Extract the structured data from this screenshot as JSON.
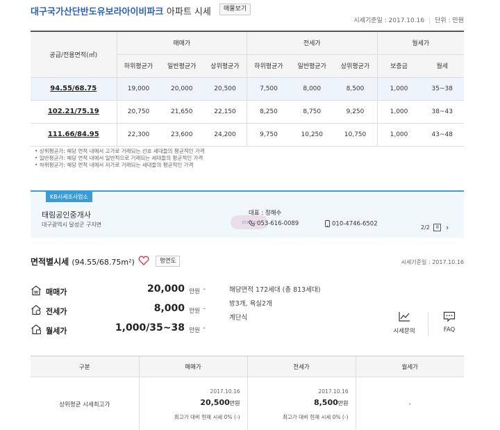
{
  "header": {
    "title": "대구국가산단반도유보라아이비파크",
    "title_suffix": "아파트 시세",
    "listing_button": "매물보기",
    "basis": "시세기준일 : 2017.10.16",
    "unit": "단위 : 만원"
  },
  "price_table": {
    "col_area": "공급/전용면적(㎡)",
    "groups": [
      "매매가",
      "전세가",
      "월세가"
    ],
    "subcols": [
      "하위평균가",
      "일반평균가",
      "상위평균가",
      "하위평균가",
      "일반평균가",
      "상위평균가",
      "보증금",
      "월세"
    ],
    "rows": [
      {
        "area": "94.55/68.75",
        "cells": [
          "19,000",
          "20,000",
          "20,500",
          "7,500",
          "8,000",
          "8,500",
          "1,000",
          "35~38"
        ]
      },
      {
        "area": "102.21/75.19",
        "cells": [
          "20,750",
          "21,650",
          "22,150",
          "8,250",
          "8,750",
          "9,250",
          "1,000",
          "38~43"
        ]
      },
      {
        "area": "111.66/84.95",
        "cells": [
          "22,300",
          "23,600",
          "24,200",
          "9,750",
          "10,250",
          "10,750",
          "1,000",
          "43~48"
        ]
      }
    ]
  },
  "notes": [
    "상위평균가: 해당 면적 내에서 고가로 거래되는 선호 세대들의 평균적인 가격",
    "일반평균가: 해당 면적 내에서 일반적으로 거래되는 세대들의 평균적인 가격",
    "하위평균가: 해당 면적 내에서 저가로 거래되는 세대들의 평균적인 가격"
  ],
  "agent": {
    "tag": "KB시세조사업소",
    "name": "태림공인중개사",
    "address": "대구광역시 달성군 구지면",
    "rep": "대표 : 정해수",
    "phone1": "053-616-0089",
    "phone2": "010-4746-6502",
    "pager": "2/2"
  },
  "area_section": {
    "title": "면적별시세",
    "title_area": "(94.55/68.75m²)",
    "floorplan_button": "평면도",
    "basis": "시세기준일 : 2017.10.16",
    "prices": [
      {
        "label": "매매가",
        "value": "20,000",
        "unit": "만원",
        "dash": "-"
      },
      {
        "label": "전세가",
        "value": "8,000",
        "unit": "만원",
        "dash": "-"
      },
      {
        "label": "월세가",
        "value": "1,000/35~38",
        "unit": "만원",
        "dash": "-"
      }
    ],
    "info": [
      "해당면적 172세대 (총 813세대)",
      "방3개, 욕실2개",
      "계단식"
    ],
    "buttons": {
      "inquiry": "시세문의",
      "faq": "FAQ"
    }
  },
  "compare_table": {
    "headers": [
      "구분",
      "매매가",
      "전세가",
      "월세가"
    ],
    "row_label": "상위평균 시세최고가",
    "sale": {
      "date": "2017.10.16",
      "value": "20,500",
      "unit": "만원",
      "compare": "최고가 대비 현재 시세 0% (-)"
    },
    "jeonse": {
      "date": "2017.10.16",
      "value": "8,500",
      "unit": "만원",
      "compare": "최고가 대비 현재 시세 0% (-)"
    },
    "monthly": "-"
  },
  "colors": {
    "brand": "#2a63b8",
    "accent": "#3b9bd9",
    "heart": "#e0334b"
  }
}
